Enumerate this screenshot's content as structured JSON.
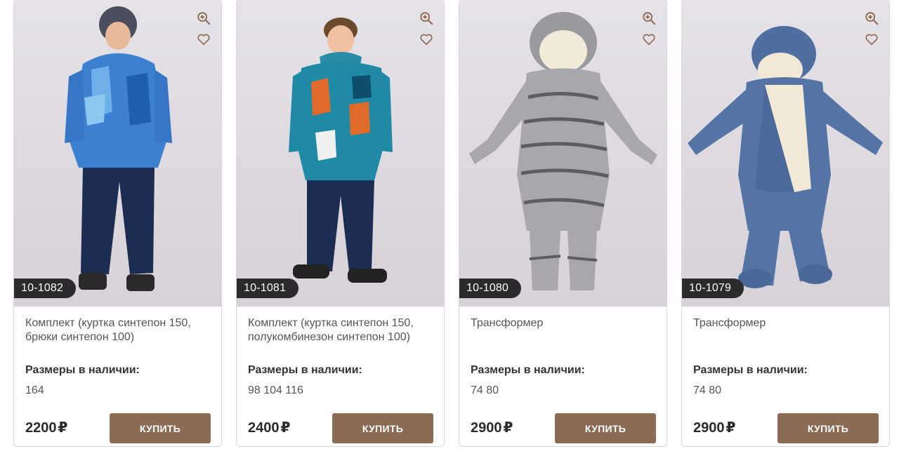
{
  "colors": {
    "button_bg": "#8b6b54",
    "sku_badge_bg": "#2b2b2b",
    "card_border": "#d9d9d9",
    "icon_color": "#8b6b54"
  },
  "icons": {
    "zoom": "zoom-in-icon",
    "favorite": "heart-icon"
  },
  "products": [
    {
      "sku": "10-1082",
      "title": "Комплект (куртка синтепон 150, брюки синтепон 100)",
      "sizes_label": "Размеры в наличии:",
      "sizes": "164",
      "price": "2200",
      "currency": "₽",
      "buy_label": "КУПИТЬ"
    },
    {
      "sku": "10-1081",
      "title": "Комплект (куртка синтепон 150, полукомбинезон синтепон 100)",
      "sizes_label": "Размеры в наличии:",
      "sizes": "98 104 116",
      "price": "2400",
      "currency": "₽",
      "buy_label": "КУПИТЬ"
    },
    {
      "sku": "10-1080",
      "title": "Трансформер",
      "sizes_label": "Размеры в наличии:",
      "sizes": "74 80",
      "price": "2900",
      "currency": "₽",
      "buy_label": "КУПИТЬ"
    },
    {
      "sku": "10-1079",
      "title": "Трансформер",
      "sizes_label": "Размеры в наличии:",
      "sizes": "74 80",
      "price": "2900",
      "currency": "₽",
      "buy_label": "КУПИТЬ"
    }
  ]
}
